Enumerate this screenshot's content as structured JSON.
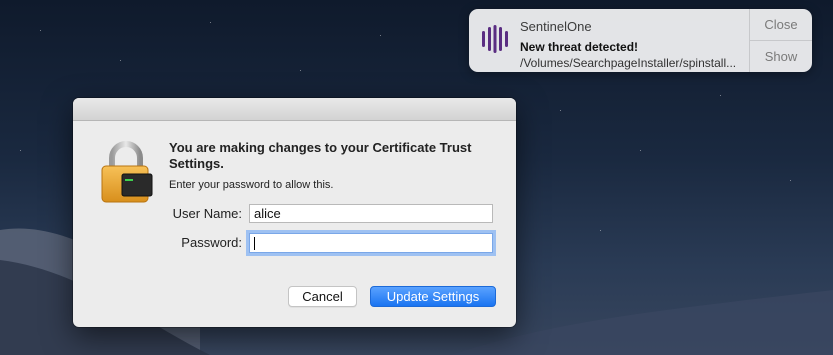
{
  "notification": {
    "app_name": "SentinelOne",
    "title": "New threat detected!",
    "body": "/Volumes/SearchpageInstaller/spinstall...",
    "close_label": "Close",
    "show_label": "Show",
    "icon": "sentinelone-logo-icon",
    "brand_color": "#5a2d82"
  },
  "dialog": {
    "heading": "You are making changes to your Certificate Trust Settings.",
    "subtext": "Enter your password to allow this.",
    "username_label": "User Name:",
    "username_value": "alice",
    "password_label": "Password:",
    "password_value": "",
    "cancel_label": "Cancel",
    "confirm_label": "Update Settings",
    "icon": "lock-icon",
    "accent_color": "#1a74f1"
  }
}
